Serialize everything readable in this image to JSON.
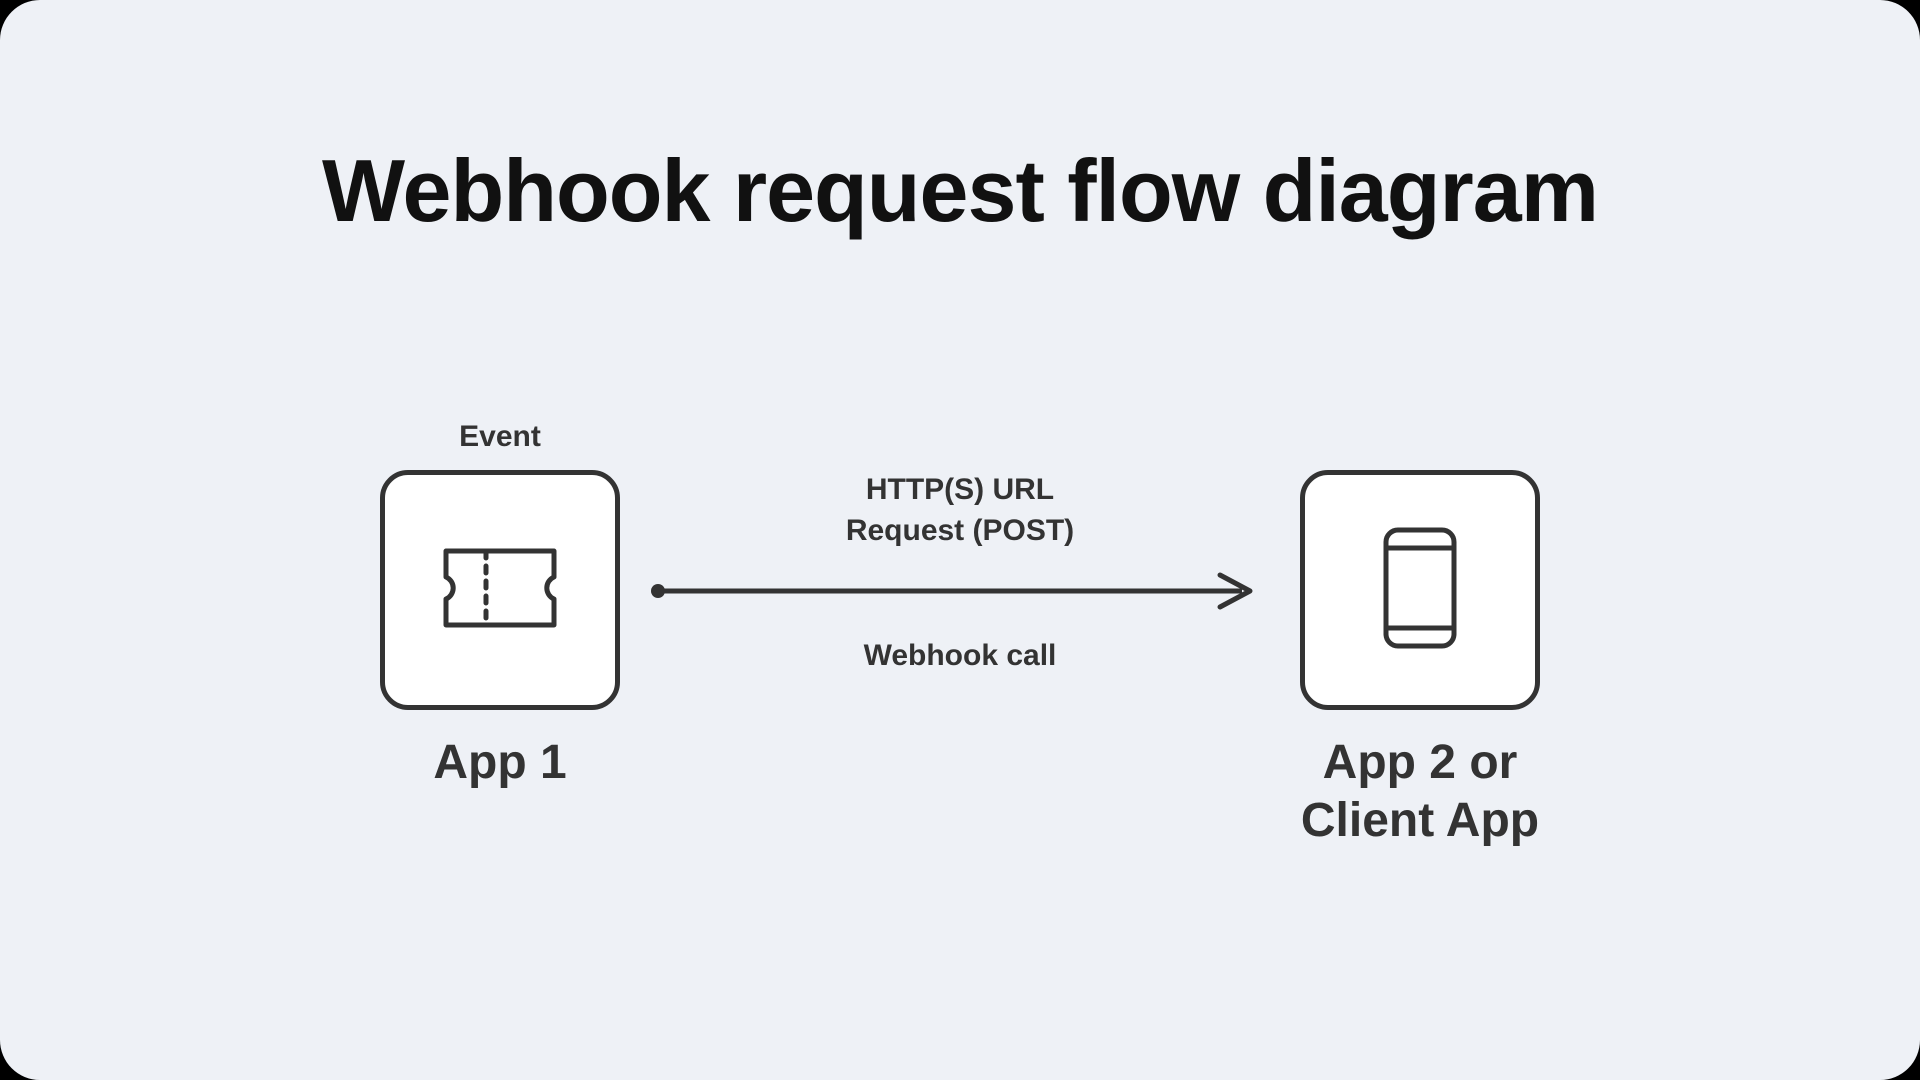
{
  "title": "Webhook request flow diagram",
  "nodes": {
    "source": {
      "top_label": "Event",
      "caption": "App 1",
      "icon": "ticket-icon"
    },
    "target": {
      "top_label": "",
      "caption": "App 2 or\nClient App",
      "icon": "phone-icon"
    }
  },
  "arrow": {
    "top_label": "HTTP(S) URL\nRequest (POST)",
    "bottom_label": "Webhook call"
  },
  "colors": {
    "background": "#eef1f6",
    "stroke": "#333333",
    "text": "#111111"
  }
}
